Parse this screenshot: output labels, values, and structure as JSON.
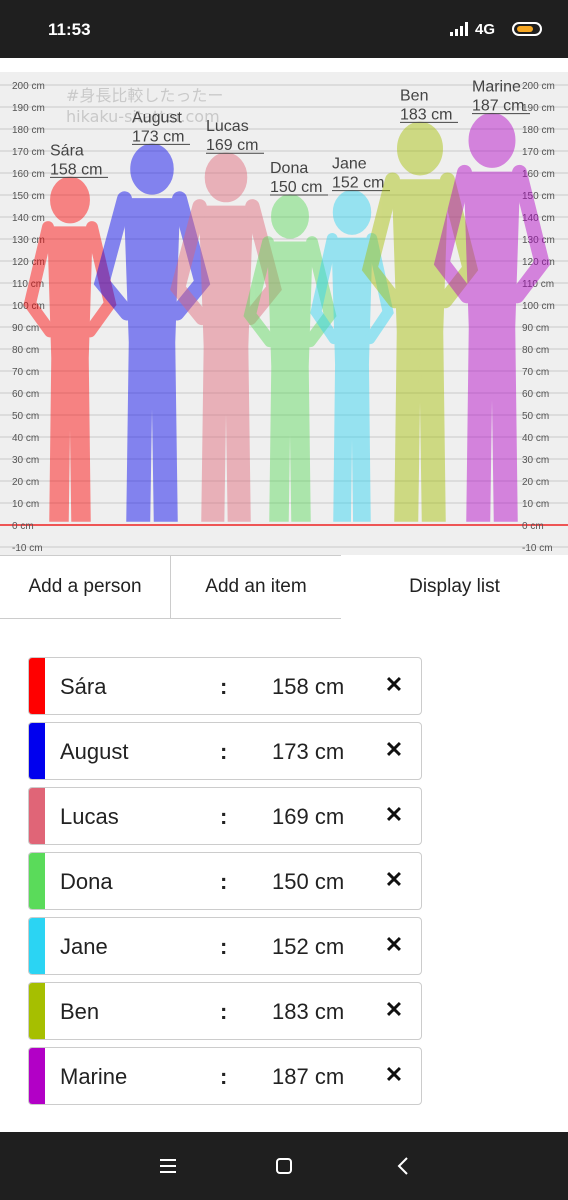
{
  "status_bar": {
    "time": "11:53",
    "network": "4G",
    "icons": [
      "signal-icon",
      "battery-icon"
    ]
  },
  "chart": {
    "watermark_line1": "#身長比較したったー",
    "watermark_line2": "hikaku-sitatter.com",
    "axis_ticks": [
      "200 cm",
      "190 cm",
      "180 cm",
      "170 cm",
      "160 cm",
      "150 cm",
      "140 cm",
      "130 cm",
      "120 cm",
      "110 cm",
      "100 cm",
      "90 cm",
      "80 cm",
      "70 cm",
      "60 cm",
      "50 cm",
      "40 cm",
      "30 cm",
      "20 cm",
      "10 cm",
      "0 cm",
      "-10 cm"
    ]
  },
  "chart_data": {
    "type": "bar",
    "categories": [
      "Sára",
      "August",
      "Lucas",
      "Dona",
      "Jane",
      "Ben",
      "Marine"
    ],
    "values": [
      158,
      173,
      169,
      150,
      152,
      183,
      187
    ],
    "ylim": [
      -10,
      200
    ],
    "ylabel": "",
    "xlabel": "",
    "title": "",
    "unit": "cm",
    "colors": [
      "#ff0000",
      "#0000ee",
      "#e06577",
      "#5adb5a",
      "#2bd4f3",
      "#a6bf00",
      "#b200c6"
    ]
  },
  "buttons": {
    "add_person": "Add a person",
    "add_item": "Add an item",
    "display_list": "Display list"
  },
  "people": [
    {
      "name": "Sára",
      "height": "158 cm",
      "color": "#ff0000"
    },
    {
      "name": "August",
      "height": "173 cm",
      "color": "#0000ee"
    },
    {
      "name": "Lucas",
      "height": "169 cm",
      "color": "#e06577"
    },
    {
      "name": "Dona",
      "height": "150 cm",
      "color": "#5adb5a"
    },
    {
      "name": "Jane",
      "height": "152 cm",
      "color": "#2bd4f3"
    },
    {
      "name": "Ben",
      "height": "183 cm",
      "color": "#a6bf00"
    },
    {
      "name": "Marine",
      "height": "187 cm",
      "color": "#b200c6"
    }
  ],
  "list_separator": ":",
  "remove_symbol": "✕",
  "nav_icons": [
    "menu-icon",
    "home-icon",
    "back-icon"
  ]
}
